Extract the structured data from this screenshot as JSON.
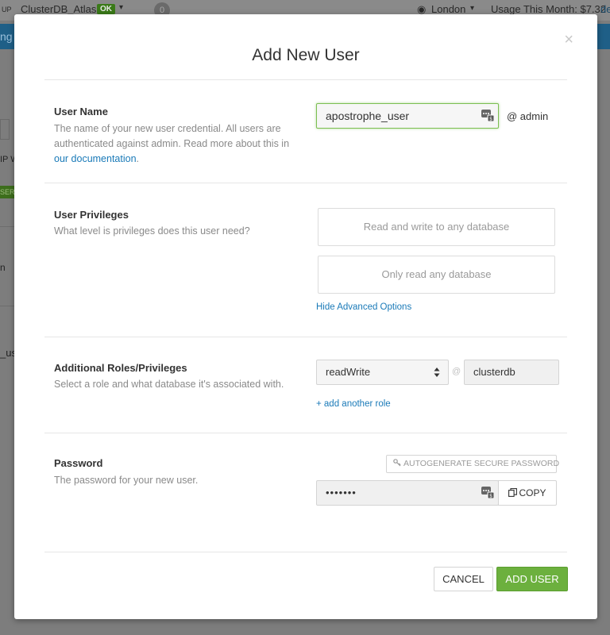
{
  "background": {
    "group_suffix": "UP",
    "cluster_name": "ClusterDB_Atlas",
    "cluster_status": "OK",
    "alert_count": "0",
    "region": "London",
    "usage_label": "Usage This Month: $7.32",
    "usage_suffix": "de",
    "banner_fragment": "ng y",
    "fragment_ip": "IP W",
    "fragment_user_badge": "SER",
    "fragment_n": "n",
    "fragment_us": "_us"
  },
  "modal": {
    "title": "Add New User",
    "close_symbol": "×",
    "user_name": {
      "title": "User Name",
      "desc_prefix": "The name of your new user credential. All users are authenticated against admin. Read more about this in ",
      "desc_link": "our documentation",
      "desc_suffix": ".",
      "value": "apostrophe_user",
      "at_label": "@ admin"
    },
    "privileges": {
      "title": "User Privileges",
      "desc": "What level is privileges does this user need?",
      "options": [
        "Read and write to any database",
        "Only read any database"
      ],
      "advanced_link": "Hide Advanced Options"
    },
    "roles": {
      "title": "Additional Roles/Privileges",
      "desc": "Select a role and what database it's associated with.",
      "role_value": "readWrite",
      "at_symbol": "@",
      "database_value": "clusterdb",
      "add_role_link": "+ add another role"
    },
    "password": {
      "title": "Password",
      "desc": "The password for your new user.",
      "autogenerate_label": "AUTOGENERATE SECURE PASSWORD",
      "value": "•••••••",
      "copy_label": "COPY"
    },
    "footer": {
      "cancel_label": "CANCEL",
      "add_user_label": "ADD USER"
    }
  }
}
